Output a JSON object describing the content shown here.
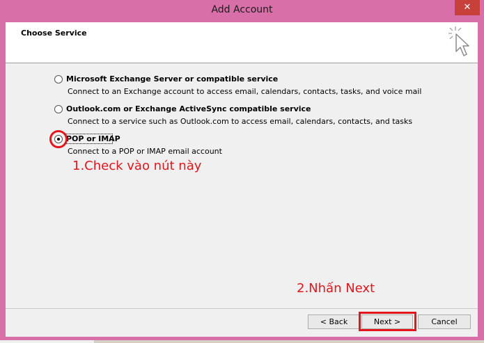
{
  "window": {
    "title": "Add Account",
    "close_glyph": "✕",
    "frame_color": "#d86fa8"
  },
  "header": {
    "title": "Choose Service",
    "icon": "cursor-sparkle-icon"
  },
  "options": [
    {
      "label": "Microsoft Exchange Server or compatible service",
      "description": "Connect to an Exchange account to access email, calendars, contacts, tasks, and voice mail",
      "selected": false
    },
    {
      "label": "Outlook.com or Exchange ActiveSync compatible service",
      "description": "Connect to a service such as Outlook.com to access email, calendars, contacts, and tasks",
      "selected": false
    },
    {
      "label": "POP or IMAP",
      "description": "Connect to a POP or IMAP email account",
      "selected": true
    }
  ],
  "annotations": {
    "step1": "1.Check vào nút này",
    "step2": "2.Nhấn Next",
    "color": "#e4161c"
  },
  "buttons": {
    "back": "< Back",
    "next": "Next >",
    "cancel": "Cancel"
  }
}
